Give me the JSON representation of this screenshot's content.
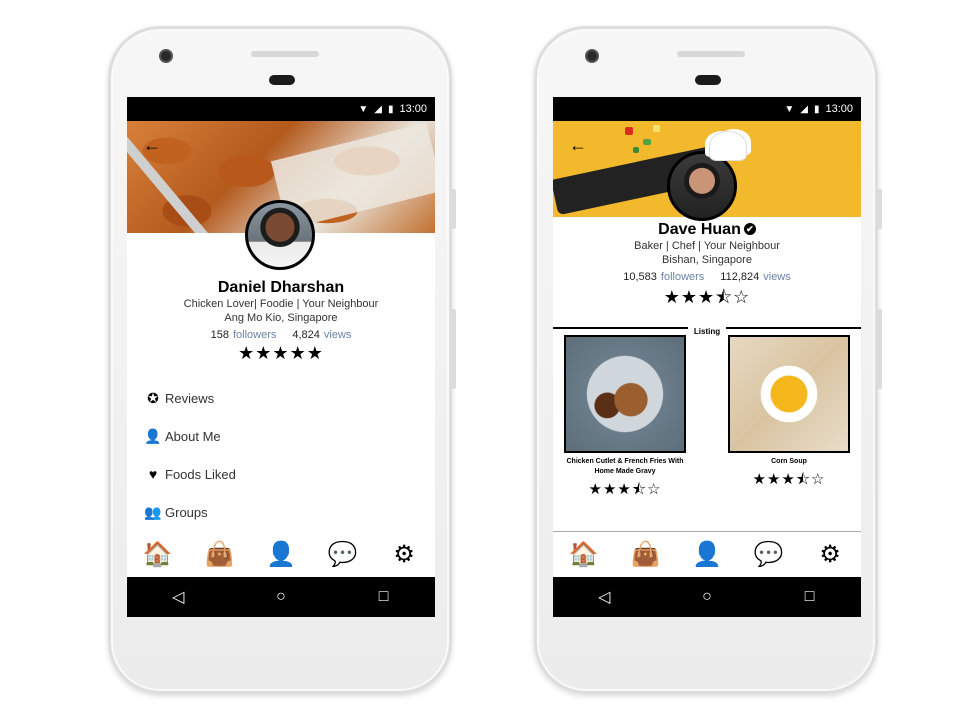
{
  "status": {
    "time": "13:00",
    "wifi_icon": "wifi-icon",
    "signal_icon": "signal-icon",
    "battery_icon": "battery-icon"
  },
  "left": {
    "profile": {
      "name": "Daniel Dharshan",
      "tagline": "Chicken Lover| Foodie | Your Neighbour",
      "location": "Ang Mo Kio, Singapore",
      "followers_count": "158",
      "followers_label": "followers",
      "views_count": "4,824",
      "views_label": "views",
      "stars": "★★★★★",
      "rating": 5
    },
    "menu": [
      {
        "label": "Reviews",
        "icon": "reviews-icon",
        "glyph": "✪"
      },
      {
        "label": "About Me",
        "icon": "person-icon",
        "glyph": "👤"
      },
      {
        "label": "Foods Liked",
        "icon": "heart-icon",
        "glyph": "♥"
      },
      {
        "label": "Groups",
        "icon": "groups-icon",
        "glyph": "👥"
      }
    ]
  },
  "right": {
    "profile": {
      "name": "Dave Huan",
      "verified_glyph": "✔",
      "tagline": "Baker | Chef | Your Neighbour",
      "location": "Bishan, Singapore",
      "followers_count": "10,583",
      "followers_label": "followers",
      "views_count": "112,824",
      "views_label": "views",
      "stars": "★★★⯪☆",
      "rating": 3.5
    },
    "listing_label": "Listing",
    "listings": [
      {
        "title": "Chicken Cutlet & French Fries With Home Made Gravy",
        "stars": "★★★⯪☆",
        "rating": 3.5
      },
      {
        "title": "Corn Soup",
        "stars": "★★★⯪☆",
        "rating": 3.5
      }
    ]
  },
  "tabbar": {
    "home": "🏠",
    "shop": "👜",
    "profile": "👤",
    "chat": "💬",
    "settings": "⚙"
  },
  "nav": {
    "back": "◁",
    "home": "○",
    "recent": "□"
  },
  "back_arrow": "←"
}
